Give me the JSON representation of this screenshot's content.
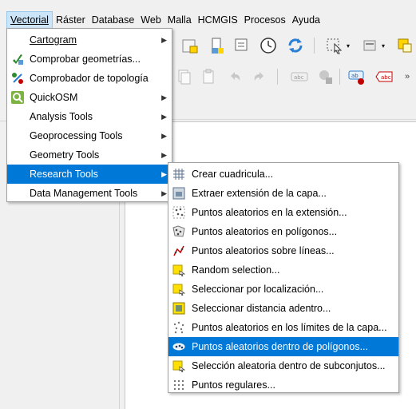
{
  "menubar": {
    "items": [
      {
        "label": "Vectorial",
        "active": true
      },
      {
        "label": "Ráster"
      },
      {
        "label": "Database"
      },
      {
        "label": "Web"
      },
      {
        "label": "Malla"
      },
      {
        "label": "HCMGIS"
      },
      {
        "label": "Procesos"
      },
      {
        "label": "Ayuda"
      }
    ]
  },
  "vector_menu": {
    "items": [
      {
        "label": "Cartogram",
        "icon": "none",
        "submenu": true
      },
      {
        "label": "Comprobar geometrías...",
        "icon": "check-geometry-icon",
        "submenu": false
      },
      {
        "label": "Comprobador de topología",
        "icon": "topology-checker-icon",
        "submenu": false
      },
      {
        "label": "QuickOSM",
        "icon": "quickosm-icon",
        "submenu": true
      },
      {
        "label": "Analysis Tools",
        "icon": "none",
        "submenu": true
      },
      {
        "label": "Geoprocessing Tools",
        "icon": "none",
        "submenu": true
      },
      {
        "label": "Geometry Tools",
        "icon": "none",
        "submenu": true
      },
      {
        "label": "Research Tools",
        "icon": "none",
        "submenu": true,
        "selected": true
      },
      {
        "label": "Data Management Tools",
        "icon": "none",
        "submenu": true
      }
    ]
  },
  "research_menu": {
    "items": [
      {
        "label": "Crear cuadricula...",
        "icon": "grid-icon"
      },
      {
        "label": "Extraer extensión de la capa...",
        "icon": "layer-extent-icon"
      },
      {
        "label": "Puntos aleatorios en la extensión...",
        "icon": "random-points-extent-icon"
      },
      {
        "label": "Puntos aleatorios en polígonos...",
        "icon": "random-points-polygons-icon"
      },
      {
        "label": "Puntos aleatorios sobre líneas...",
        "icon": "random-points-lines-icon"
      },
      {
        "label": "Random selection...",
        "icon": "random-selection-icon"
      },
      {
        "label": "Seleccionar por localización...",
        "icon": "select-by-location-icon"
      },
      {
        "label": "Seleccionar distancia adentro...",
        "icon": "select-within-distance-icon"
      },
      {
        "label": "Puntos aleatorios en los límites de la capa...",
        "icon": "random-points-bounds-icon"
      },
      {
        "label": "Puntos aleatorios dentro de polígonos...",
        "icon": "random-points-inside-polygons-icon",
        "selected": true
      },
      {
        "label": "Selección aleatoria dentro de subconjutos...",
        "icon": "random-subset-selection-icon"
      },
      {
        "label": "Puntos regulares...",
        "icon": "regular-points-icon"
      }
    ]
  },
  "colors": {
    "selection": "#0078d7",
    "menubar_active": "#cce4f7"
  }
}
